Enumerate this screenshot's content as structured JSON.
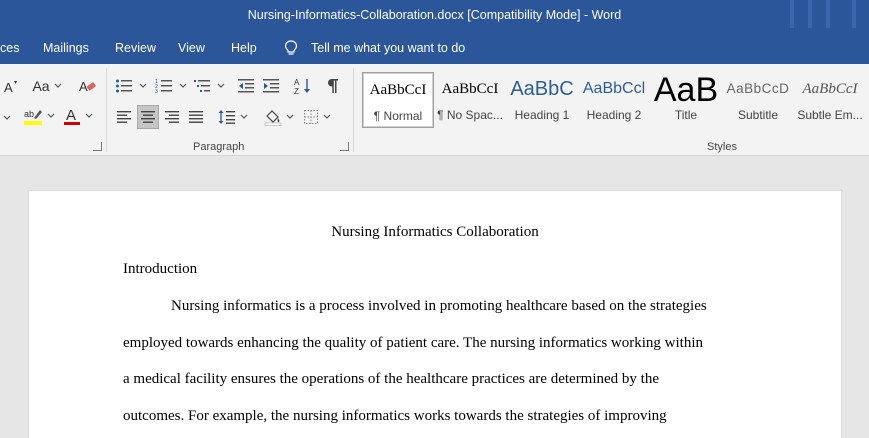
{
  "window": {
    "title": "Nursing-Informatics-Collaboration.docx [Compatibility Mode]  -  Word"
  },
  "menu": {
    "items": [
      {
        "label": "ces"
      },
      {
        "label": "Mailings"
      },
      {
        "label": "Review"
      },
      {
        "label": "View"
      },
      {
        "label": "Help"
      }
    ],
    "tell_me": "Tell me what you want to do"
  },
  "ribbon": {
    "font_group": {
      "change_case": "Aa"
    },
    "paragraph_label": "Paragraph",
    "styles_label": "Styles",
    "styles": [
      {
        "sample": "AaBbCcI",
        "name": "¶ Normal"
      },
      {
        "sample": "AaBbCcI",
        "name": "¶ No Spac..."
      },
      {
        "sample": "AaBbC",
        "name": "Heading 1"
      },
      {
        "sample": "AaBbCcl",
        "name": "Heading 2"
      },
      {
        "sample": "AaB",
        "name": "Title"
      },
      {
        "sample": "AaBbCcD",
        "name": "Subtitle"
      },
      {
        "sample": "AaBbCcI",
        "name": "Subtle Em..."
      }
    ],
    "colors": {
      "highlight": "#ffff00",
      "font_color": "#d00000"
    }
  },
  "document": {
    "title": "Nursing Informatics Collaboration",
    "heading": "Introduction",
    "lines": [
      "Nursing informatics is a process involved in promoting healthcare based on the strategies",
      "employed towards enhancing the quality of patient care. The nursing informatics working within",
      "a medical facility ensures the operations of the healthcare practices are determined by the",
      "outcomes. For example, the nursing informatics works towards the strategies of improving"
    ]
  },
  "theme": {
    "word_blue": "#2b579a"
  }
}
